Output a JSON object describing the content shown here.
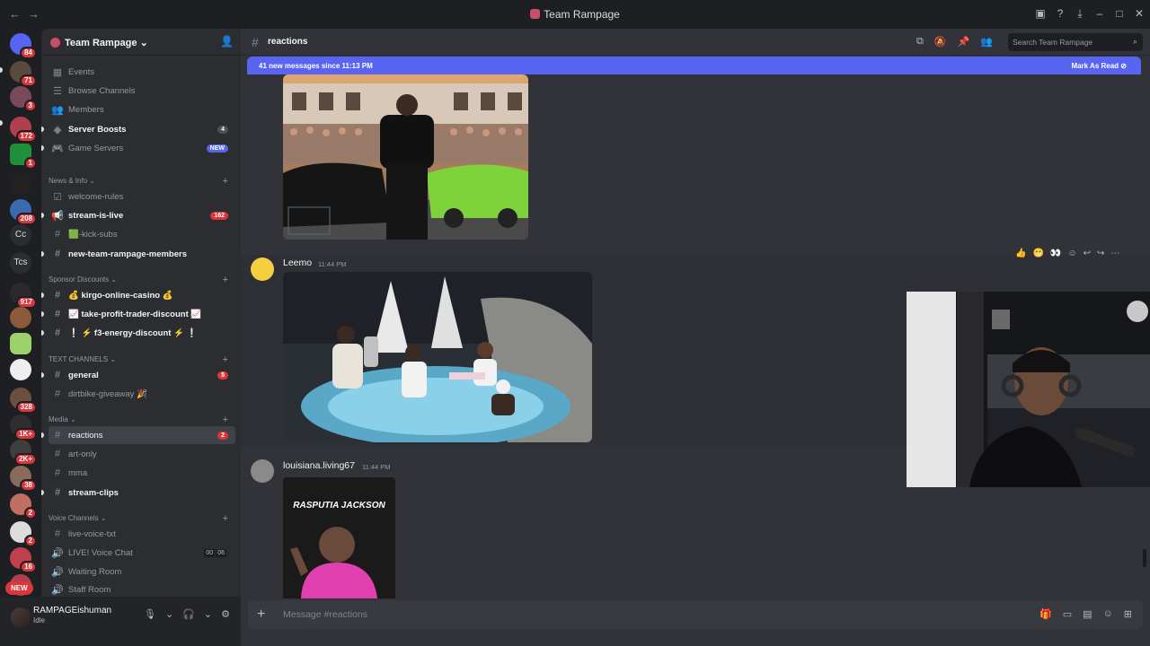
{
  "window": {
    "title": "Team Rampage"
  },
  "rail": {
    "badges": [
      "84",
      "71",
      "3",
      "172",
      "1",
      "208",
      "917",
      "328",
      "1K+",
      "2K+",
      "38",
      "2",
      "2",
      "16"
    ],
    "text_servers": [
      "Cc",
      "Tcs"
    ],
    "new_label": "NEW"
  },
  "server": {
    "name": "Team Rampage"
  },
  "sidebar": {
    "top_items": [
      {
        "label": "Events"
      },
      {
        "label": "Browse Channels"
      },
      {
        "label": "Members"
      },
      {
        "label": "Server Boosts",
        "count": "4"
      },
      {
        "label": "Game Servers",
        "count": "NEW"
      }
    ],
    "categories": {
      "news": "News & Info",
      "sponsor": "Sponsor Discounts",
      "text": "TEXT CHANNELS",
      "media": "Media",
      "voice": "Voice Channels"
    },
    "channels": {
      "welcome_rules": "welcome-rules",
      "stream_is_live": "stream-is-live",
      "stream_is_live_count": "162",
      "kick_subs": "🟩-kick-subs",
      "new_members": "new-team-rampage-members",
      "kirgo": "💰 kirgo-online-casino 💰",
      "take_profit": "📈 take-profit-trader-discount 📈",
      "f3_energy": "❕ ⚡ f3-energy-discount ⚡ ❕",
      "general": "general",
      "general_count": "5",
      "dirtbike": "dirtbike-giveaway 🎉",
      "reactions": "reactions",
      "reactions_count": "2",
      "art_only": "art-only",
      "mma": "mma",
      "stream_clips": "stream-clips",
      "live_voice_txt": "live-voice-txt",
      "live_voice_chat": "LIVE! Voice Chat",
      "voice_left": "00",
      "voice_right": "06",
      "waiting_room": "Waiting Room",
      "staff_room": "Staff Room"
    }
  },
  "user": {
    "name": "RAMPAGEishuman",
    "status": "Idle"
  },
  "channel": {
    "name": "reactions",
    "search_placeholder": "Search Team Rampage"
  },
  "new_messages": {
    "text": "41 new messages since 11:13 PM",
    "mark_read": "Mark As Read"
  },
  "messages": [
    {
      "author": "Leemo",
      "time": "11:44 PM"
    },
    {
      "author": "louisiana.living67",
      "time": "11:44 PM",
      "image_caption": "RASPUTIA JACKSON"
    }
  ],
  "composer": {
    "placeholder": "Message #reactions"
  }
}
